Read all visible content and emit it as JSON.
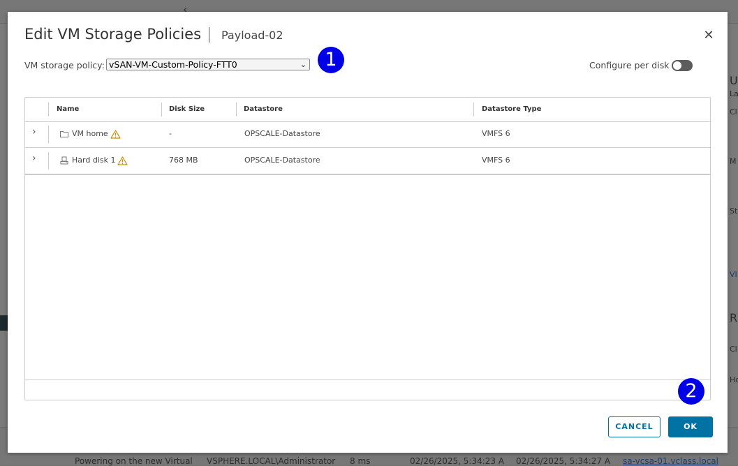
{
  "background": {
    "rows": [
      "Powering on the new Virtual",
      "VSPHERE.LOCAL\\Administrator",
      "8 ms",
      "02/26/2025, 5:34:23 A",
      "02/26/2025, 5:34:27 A",
      "sa-vcsa-01.vclass.local"
    ],
    "right_fragments": [
      "U",
      "La",
      "Cl",
      "M",
      "St",
      "VI",
      "R",
      "Cl",
      "Ho"
    ]
  },
  "dialog": {
    "title": "Edit VM Storage Policies",
    "subtitle": "Payload-02",
    "close_glyph": "✕",
    "policy": {
      "label": "VM storage policy:",
      "selected": "vSAN-VM-Custom-Policy-FTT0",
      "chevron": "⌄"
    },
    "configure_per_disk": {
      "label": "Configure per disk",
      "enabled": false
    },
    "annotations": [
      "1",
      "2"
    ],
    "table": {
      "columns": [
        "Name",
        "Disk Size",
        "Datastore",
        "Datastore Type"
      ],
      "rows": [
        {
          "icon": "folder-icon",
          "name": "VM home",
          "size": "-",
          "datastore": "OPSCALE-Datastore",
          "type": "VMFS 6",
          "expander": "›"
        },
        {
          "icon": "hard-disk-icon",
          "name": "Hard disk 1",
          "size": "768 MB",
          "datastore": "OPSCALE-Datastore",
          "type": "VMFS 6",
          "expander": "›"
        }
      ]
    },
    "buttons": {
      "cancel": "CANCEL",
      "ok": "OK"
    },
    "colors": {
      "accent": "#0072a3",
      "badge": "#0000e6",
      "warning": "#c88b00"
    }
  }
}
